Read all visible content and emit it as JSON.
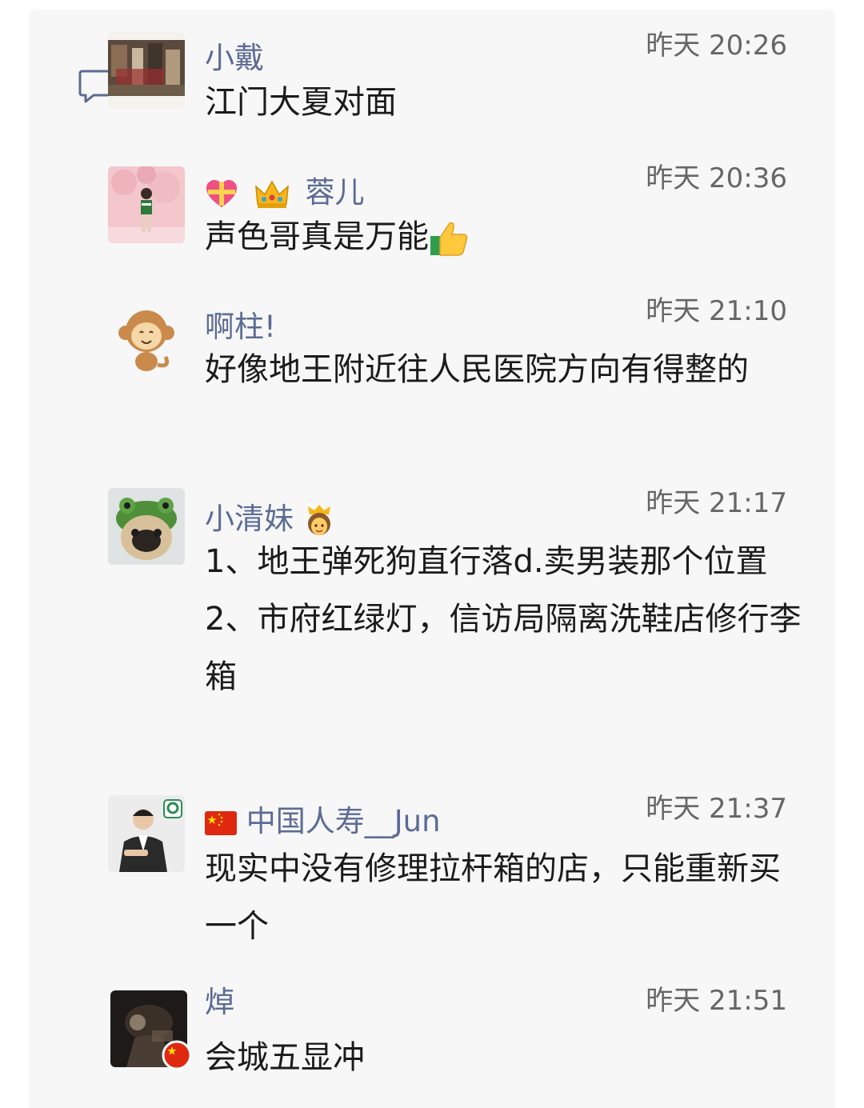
{
  "comments": [
    {
      "name": "小戴",
      "time": "昨天 20:26",
      "lines": [
        "江门大夏对面"
      ]
    },
    {
      "name": "蓉儿",
      "time": "昨天 20:36",
      "lines": [
        "声色哥真是万能"
      ]
    },
    {
      "name": "啊柱!",
      "time": "昨天 21:10",
      "lines": [
        "好像地王附近往人民医院方向有得整的"
      ]
    },
    {
      "name": "小清妹",
      "time": "昨天 21:17",
      "lines": [
        "1、地王弹死狗直行落d.卖男装那个位置",
        "2、市府红绿灯，信访局隔离洗鞋店修行李箱"
      ]
    },
    {
      "name": "中国人寿__Jun",
      "time": "昨天 21:37",
      "lines": [
        "现实中没有修理拉杆箱的店，只能重新买一个"
      ]
    },
    {
      "name": "焯",
      "time": "昨天 21:51",
      "lines": [
        "会城五显冲"
      ]
    }
  ],
  "icons": {
    "comment": "comment-icon",
    "gift_heart": "gift-heart-emoji",
    "crown": "crown-emoji",
    "thumbs_up": "thumbs-up-emoji",
    "princess": "princess-emoji",
    "china_flag": "china-flag-icon"
  },
  "colors": {
    "name": "#5b6b94",
    "time": "#666666",
    "text": "#1b1b1b",
    "panel": "#f7f7f7"
  }
}
